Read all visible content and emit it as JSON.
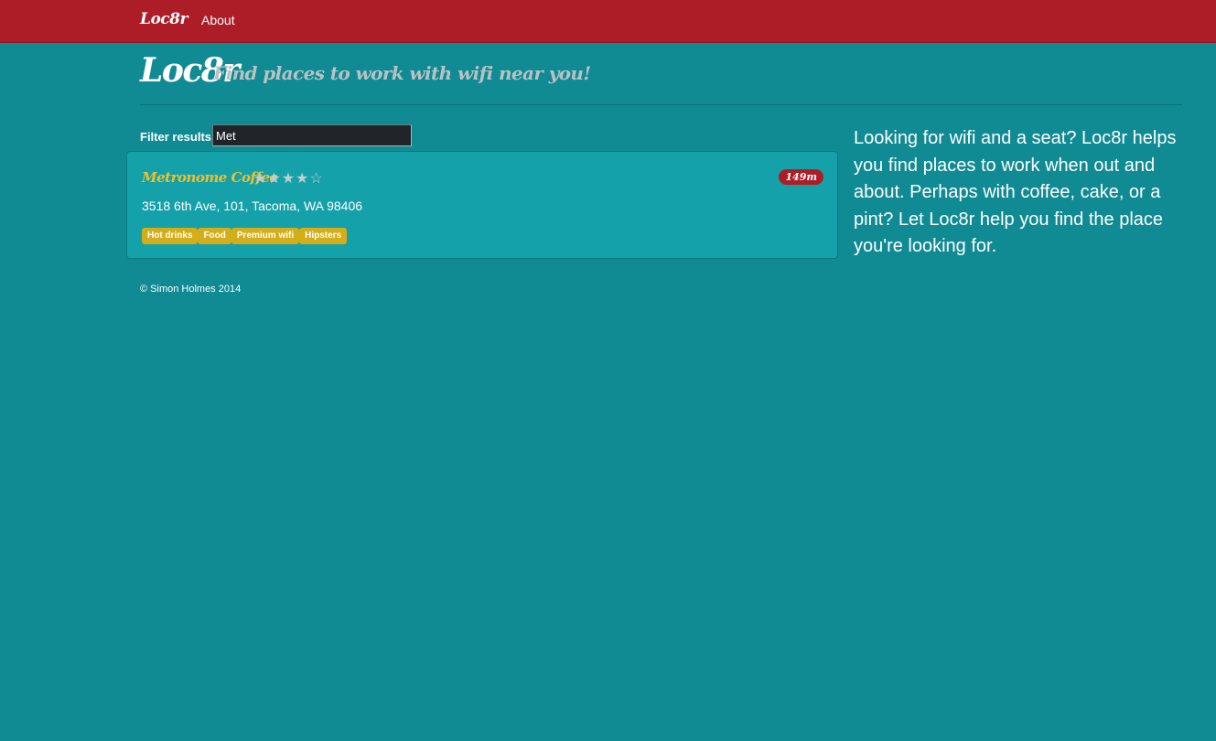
{
  "navbar": {
    "brand": "Loc8r",
    "about_label": "About"
  },
  "header": {
    "title": "Loc8r",
    "tagline": "Find places to work with wifi near you!"
  },
  "filter": {
    "label": "Filter results",
    "value": "Met"
  },
  "locations": [
    {
      "name": "Metronome Coffee",
      "rating": 4,
      "stars_text": "★★★★☆",
      "distance": "149m",
      "address": "3518 6th Ave, 101, Tacoma, WA 98406",
      "facilities": [
        "Hot drinks",
        "Food",
        "Premium wifi",
        "Hipsters"
      ]
    }
  ],
  "sidebar": {
    "text": "Looking for wifi and a seat? Loc8r helps you find places to work when out and about. Perhaps with coffee, cake, or a pint? Let Loc8r help you find the place you're looking for."
  },
  "footer": {
    "text": "© Simon Holmes 2014"
  },
  "colors": {
    "background": "#108a93",
    "navbar": "#ad1d28",
    "card": "#15a1aa",
    "accent_yellow": "#f0c02a",
    "facility_badge": "#d4ad18"
  }
}
